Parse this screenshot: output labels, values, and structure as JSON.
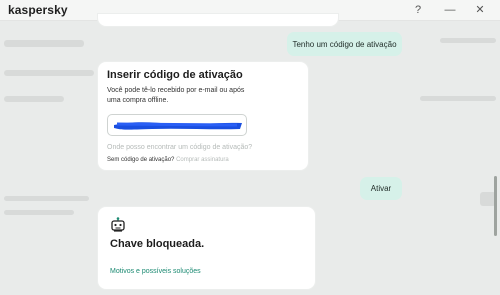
{
  "app": {
    "title": "kaspersky"
  },
  "window_controls": {
    "help": "?",
    "minimize": "—",
    "close": "✕"
  },
  "chat": {
    "user_message_1": "Tenho um código de ativação",
    "activation_card": {
      "title": "Inserir código de ativação",
      "description": "Você pode tê-lo recebido por e-mail ou após uma compra offline.",
      "code_input_value": "",
      "help_link": "Onde posso encontrar um código de ativação?",
      "no_code_text": "Sem código de ativação?",
      "buy_link": "Comprar assinatura"
    },
    "user_message_2": "Ativar",
    "blocked_card": {
      "icon": "robot-icon",
      "title": "Chave bloqueada.",
      "link": "Motivos e possíveis soluções"
    }
  },
  "colors": {
    "user_bubble": "#d6f1e9",
    "teal_link": "#1b8a72",
    "redaction": "#1a4fe0"
  }
}
